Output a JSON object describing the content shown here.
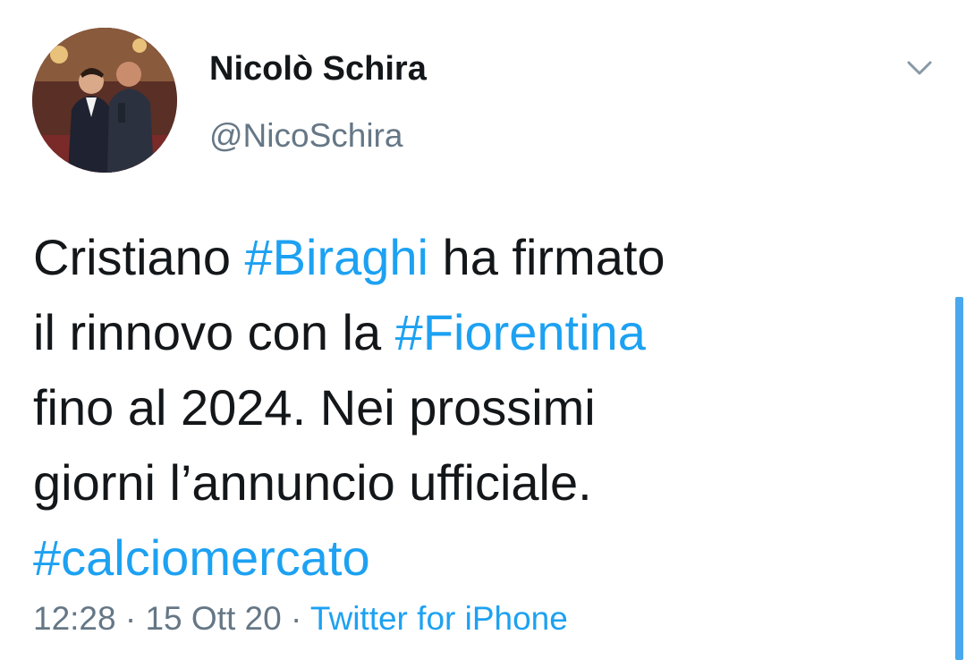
{
  "tweet": {
    "author": {
      "display_name": "Nicolò Schira",
      "handle": "@NicoSchira"
    },
    "text_parts": {
      "l1_a": "Cristiano ",
      "l1_tag": "#Biraghi",
      "l1_b": " ha firmato",
      "l2_a": "il rinnovo con la ",
      "l2_tag": "#Fiorentina",
      "l3": "fino al 2024. Nei prossimi",
      "l4": "giorni l’annuncio ufficiale.",
      "l5_tag": "#calciomercato"
    },
    "time": "12:28",
    "separator": " · ",
    "date": "15 Ott 20",
    "source": "Twitter for iPhone"
  },
  "colors": {
    "link": "#1da1f2",
    "text": "#14171a",
    "muted": "#657786",
    "scrollbar": "#4aa8ee"
  },
  "icons": {
    "menu": "chevron-down-icon"
  }
}
